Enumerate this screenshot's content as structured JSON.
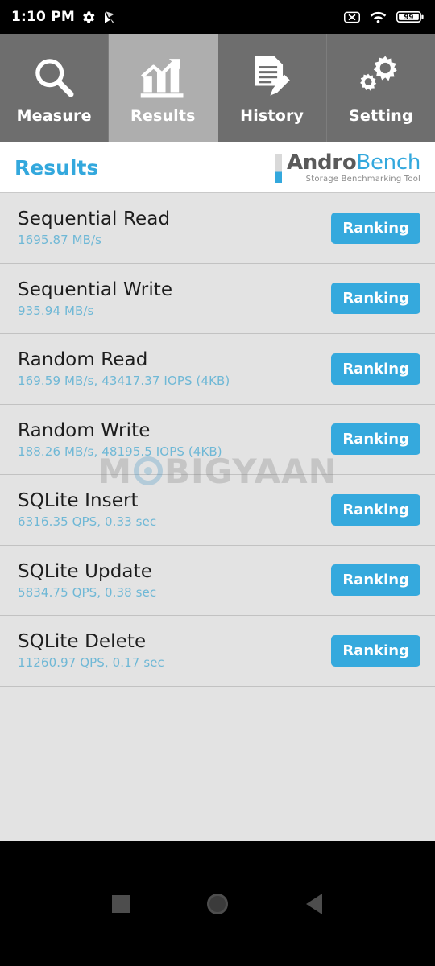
{
  "statusbar": {
    "time": "1:10 PM",
    "left_icons": [
      "gear-icon",
      "play-store-icon"
    ],
    "right_icons": [
      "no-sim-icon",
      "wifi-icon",
      "battery-icon"
    ],
    "battery_level": "99"
  },
  "tabs": [
    {
      "label": "Measure",
      "icon": "magnifier-icon",
      "active": false
    },
    {
      "label": "Results",
      "icon": "bar-chart-icon",
      "active": true
    },
    {
      "label": "History",
      "icon": "document-pencil-icon",
      "active": false
    },
    {
      "label": "Setting",
      "icon": "gears-icon",
      "active": false
    }
  ],
  "header": {
    "page_title": "Results",
    "logo_primary": "Andro",
    "logo_secondary": "Bench",
    "logo_subtitle": "Storage Benchmarking Tool"
  },
  "results": {
    "button_label": "Ranking",
    "rows": [
      {
        "title": "Sequential Read",
        "value": "1695.87 MB/s"
      },
      {
        "title": "Sequential Write",
        "value": "935.94 MB/s"
      },
      {
        "title": "Random Read",
        "value": "169.59 MB/s, 43417.37 IOPS (4KB)"
      },
      {
        "title": "Random Write",
        "value": "188.26 MB/s, 48195.5 IOPS (4KB)"
      },
      {
        "title": "SQLite Insert",
        "value": "6316.35 QPS, 0.33 sec"
      },
      {
        "title": "SQLite Update",
        "value": "5834.75 QPS, 0.38 sec"
      },
      {
        "title": "SQLite Delete",
        "value": "11260.97 QPS, 0.17 sec"
      }
    ]
  },
  "watermark": {
    "part1": "M",
    "part2": "BIGYAAN"
  },
  "navbar": {
    "recents_label": "recents",
    "home_label": "home",
    "back_label": "back"
  },
  "colors": {
    "accent_blue": "#35a9dd",
    "value_blue": "#6fb8d6",
    "tab_inactive": "#6e6e6e",
    "tab_active": "#aeaeae",
    "list_bg": "#e3e3e3"
  }
}
